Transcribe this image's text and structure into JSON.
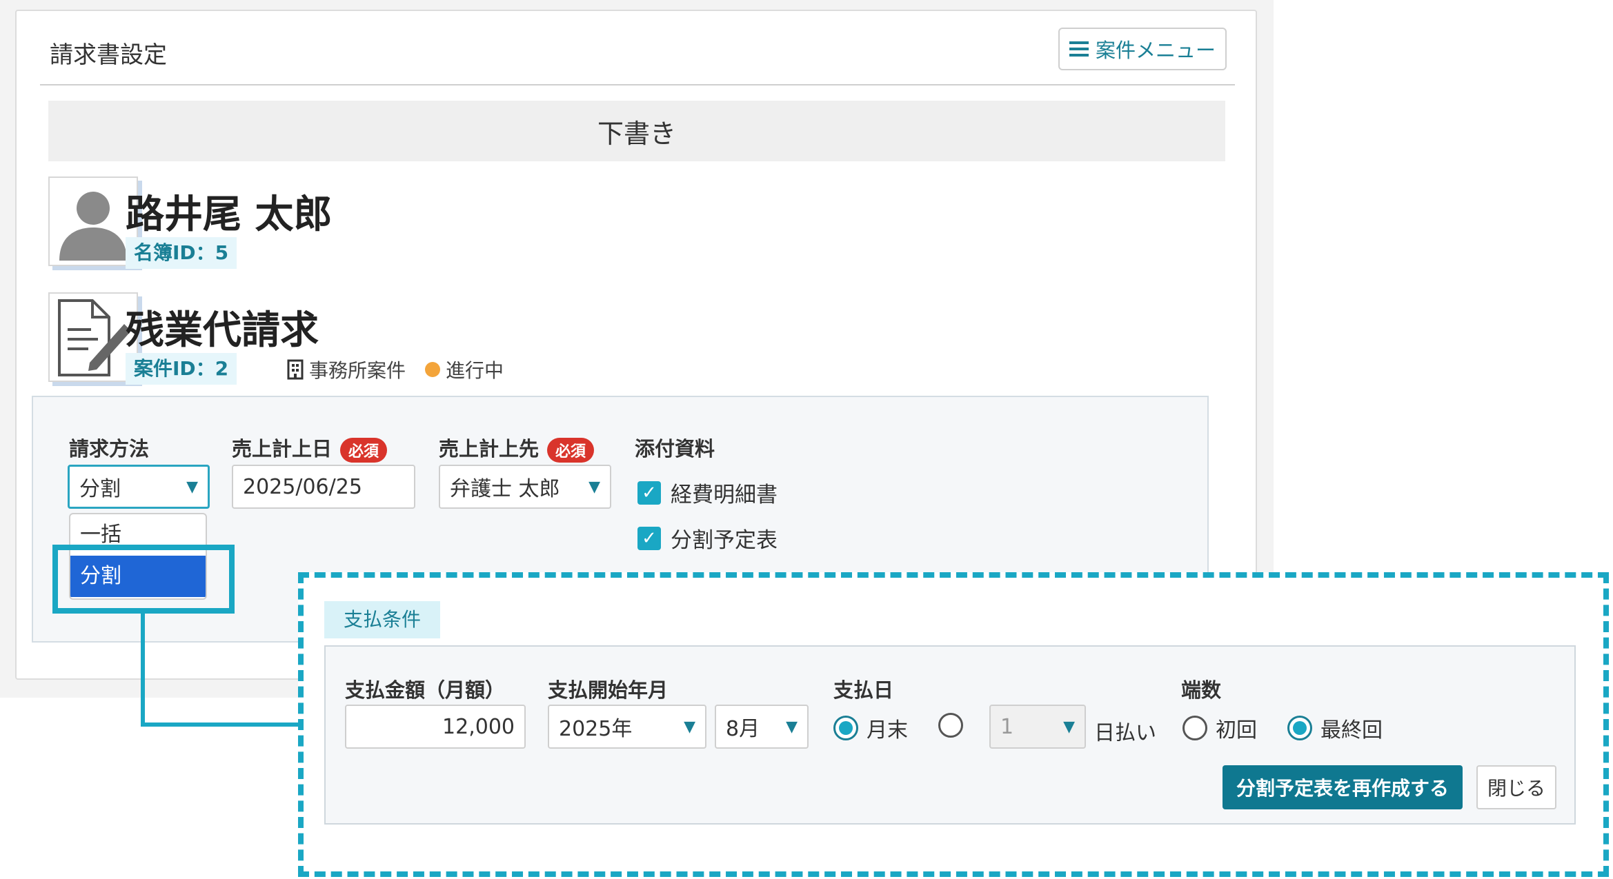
{
  "panel": {
    "title": "請求書設定",
    "menu_label": "案件メニュー"
  },
  "status": "下書き",
  "client": {
    "name": "路井尾 太郎",
    "id_label": "名簿ID：5"
  },
  "matter": {
    "name": "残業代請求",
    "id_label": "案件ID：2",
    "type_label": "事務所案件",
    "progress_label": "進行中"
  },
  "form": {
    "method_label": "請求方法",
    "method_value": "分割",
    "method_options": [
      "一括",
      "分割"
    ],
    "date_label": "売上計上日",
    "required_badge": "必須",
    "date_value": "2025/06/25",
    "dest_label": "売上計上先",
    "dest_value": "弁護士 太郎",
    "attach_label": "添付資料",
    "attachments": [
      "経費明細書",
      "分割予定表"
    ]
  },
  "payment": {
    "tag": "支払条件",
    "amount_label": "支払金額（月額）",
    "amount_value": "12,000",
    "start_label": "支払開始年月",
    "year_value": "2025年",
    "month_value": "8月",
    "day_label": "支払日",
    "day_month_end": "月末",
    "day_number_value": "1",
    "day_suffix": "日払い",
    "fraction_label": "端数",
    "fraction_first": "初回",
    "fraction_last": "最終回",
    "rebuild_button": "分割予定表を再作成する",
    "close_button": "閉じる"
  },
  "colors": {
    "accent": "#1aa7c4",
    "primary": "#0f7890",
    "required": "#d9342b",
    "progress": "#f3a43a"
  }
}
